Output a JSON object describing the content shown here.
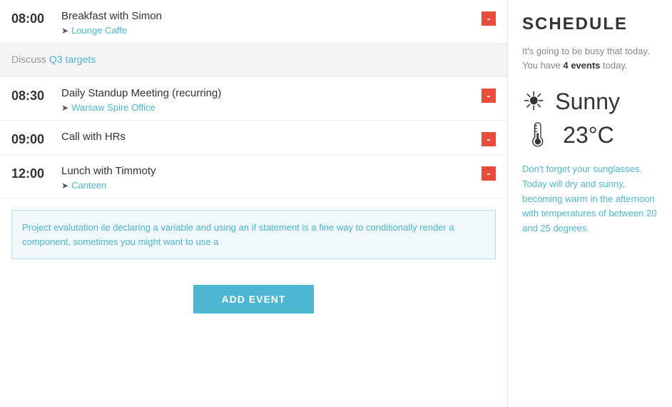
{
  "schedule": {
    "title": "SCHEDULE",
    "subtitle_before": "It's going to be busy that today. You have ",
    "event_count": "4 events",
    "subtitle_after": " today.",
    "weather": {
      "condition": "Sunny",
      "temperature": "23°C",
      "description": "Don't forget your sunglasses. Today will dry and sunny, becoming warm in the afternoon with temperatures of between 20 and 25 degrees."
    }
  },
  "events": [
    {
      "time": "08:00",
      "title": "Breakfast with Simon",
      "location": "Lounge Caffe",
      "has_delete": true
    },
    {
      "time": "08:30",
      "title": "Daily Standup Meeting (recurring)",
      "location": "Warsaw Spire Office",
      "has_delete": true
    },
    {
      "time": "09:00",
      "title": "Call with HRs",
      "location": null,
      "has_delete": true
    },
    {
      "time": "12:00",
      "title": "Lunch with Timmoty",
      "location": "Canteen",
      "has_delete": true
    }
  ],
  "notes": {
    "q3_note": "Discuss Q3 targets",
    "project_note": "Project evalutation ile declaring a variable and using an if statement is a fine way to conditionally render a component, sometimes you might want to use a"
  },
  "buttons": {
    "add_event": "ADD EVENT"
  }
}
